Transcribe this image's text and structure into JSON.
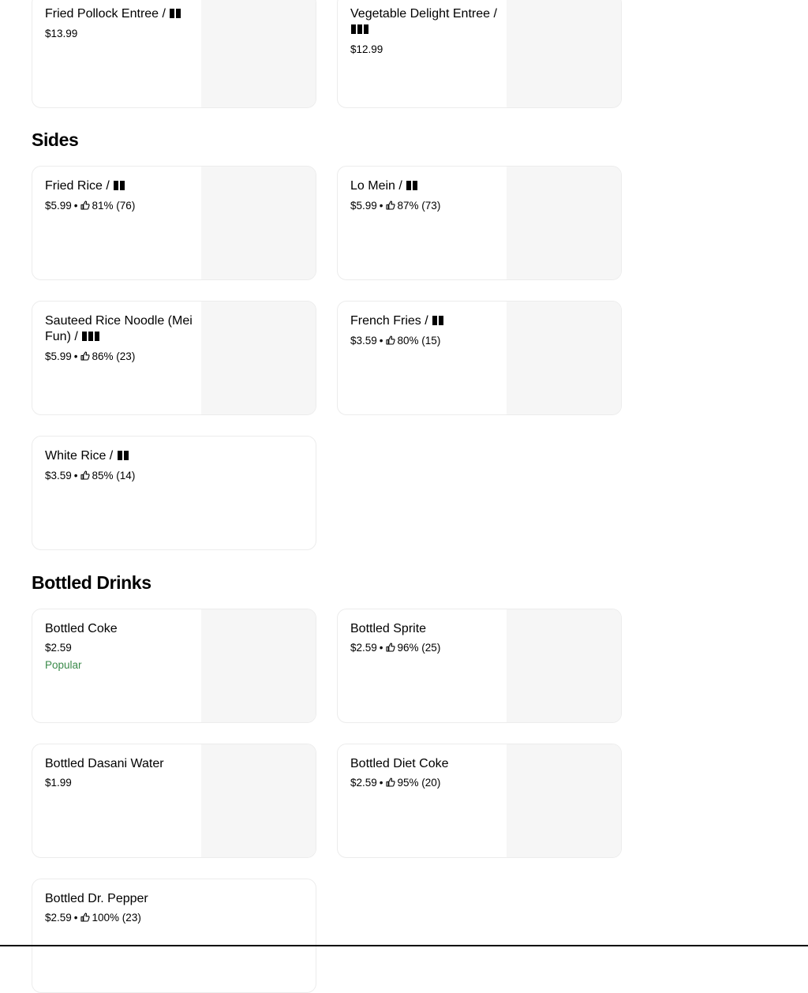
{
  "sections": {
    "entrees": {
      "items": [
        {
          "name": "Fried Pollock Entree /",
          "spice_level": 2,
          "price": "$13.99"
        },
        {
          "name": "Vegetable Delight Entree /",
          "spice_level": 3,
          "price": "$12.99"
        }
      ]
    },
    "sides": {
      "title": "Sides",
      "items": [
        {
          "name": "Fried Rice /",
          "spice_level": 2,
          "price": "$5.99",
          "rating": "81% (76)"
        },
        {
          "name": "Lo Mein /",
          "spice_level": 2,
          "price": "$5.99",
          "rating": "87% (73)"
        },
        {
          "name": "Sauteed Rice Noodle (Mei Fun) /",
          "spice_level": 3,
          "price": "$5.99",
          "rating": "86% (23)"
        },
        {
          "name": "French Fries /",
          "spice_level": 2,
          "price": "$3.59",
          "rating": "80% (15)"
        },
        {
          "name": "White Rice /",
          "spice_level": 2,
          "price": "$3.59",
          "rating": "85% (14)"
        }
      ]
    },
    "bottled_drinks": {
      "title": "Bottled Drinks",
      "items": [
        {
          "name": "Bottled Coke",
          "price": "$2.59",
          "badge": "Popular"
        },
        {
          "name": "Bottled Sprite",
          "price": "$2.59",
          "rating": "96% (25)"
        },
        {
          "name": "Bottled Dasani Water",
          "price": "$1.99"
        },
        {
          "name": "Bottled Diet Coke",
          "price": "$2.59",
          "rating": "95% (20)"
        },
        {
          "name": "Bottled Dr. Pepper",
          "price": "$2.59",
          "rating": "100% (23)"
        }
      ]
    }
  },
  "meta_separator": "•",
  "icons": {
    "rating": "thumbs-up-icon",
    "spice": "chili-pepper-icon"
  },
  "colors": {
    "popular_badge": "#3a8a4a",
    "card_border": "#ececec",
    "image_placeholder": "#f6f6f6"
  }
}
